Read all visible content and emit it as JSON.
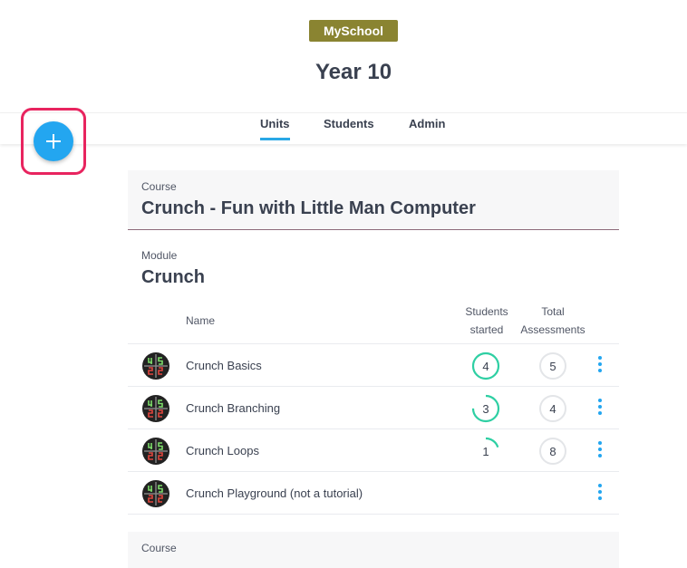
{
  "header": {
    "school_badge": "MySchool",
    "title": "Year 10"
  },
  "tabs": [
    {
      "label": "Units",
      "active": true
    },
    {
      "label": "Students",
      "active": false
    },
    {
      "label": "Admin",
      "active": false
    }
  ],
  "fab": {
    "icon": "plus-icon",
    "highlight_color": "#e8245f",
    "color": "#23a6f0"
  },
  "course": {
    "label": "Course",
    "name": "Crunch - Fun with Little Man Computer"
  },
  "module": {
    "label": "Module",
    "name": "Crunch"
  },
  "table": {
    "headers": {
      "name": "Name",
      "students_started_line1": "Students",
      "students_started_line2": "started",
      "total_assessments_line1": "Total",
      "total_assessments_line2": "Assessments"
    },
    "rows": [
      {
        "name": "Crunch Basics",
        "students_started": "4",
        "started_progress": 1.0,
        "total_assessments": "5"
      },
      {
        "name": "Crunch Branching",
        "students_started": "3",
        "started_progress": 0.75,
        "total_assessments": "4"
      },
      {
        "name": "Crunch Loops",
        "students_started": "1",
        "started_progress": 0.2,
        "total_assessments": "8"
      },
      {
        "name": "Crunch Playground (not a tutorial)",
        "students_started": "",
        "started_progress": 0,
        "total_assessments": ""
      }
    ]
  },
  "next_course": {
    "label": "Course"
  },
  "colors": {
    "badge": "#8a8431",
    "accent": "#23a6f0",
    "progress": "#2ecfa3",
    "ring_empty": "#e3e5e8"
  }
}
